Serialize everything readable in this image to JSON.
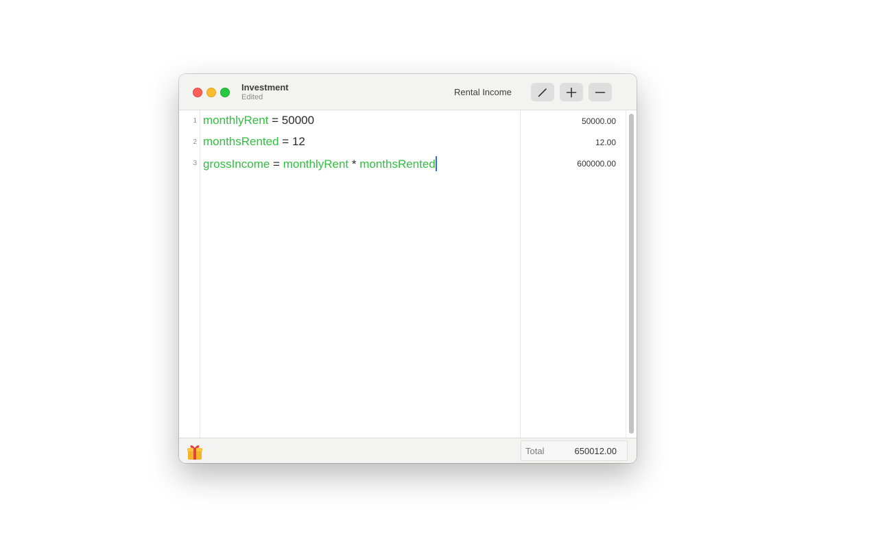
{
  "window": {
    "title": "Investment",
    "subtitle": "Edited",
    "sheet_name": "Rental Income"
  },
  "toolbar": {
    "buttons": [
      {
        "name": "edit",
        "icon": "pencil-icon"
      },
      {
        "name": "add",
        "icon": "plus-icon"
      },
      {
        "name": "remove",
        "icon": "minus-icon"
      }
    ]
  },
  "editor": {
    "lines": [
      {
        "number": "1",
        "tokens": [
          {
            "text": "monthlyRent",
            "kind": "variable"
          },
          {
            "text": " = 50000",
            "kind": "plain"
          }
        ],
        "result": "50000.00"
      },
      {
        "number": "2",
        "tokens": [
          {
            "text": "monthsRented",
            "kind": "variable"
          },
          {
            "text": " = 12",
            "kind": "plain"
          }
        ],
        "result": "12.00"
      },
      {
        "number": "3",
        "tokens": [
          {
            "text": "grossIncome",
            "kind": "variable"
          },
          {
            "text": " = ",
            "kind": "plain"
          },
          {
            "text": "monthlyRent",
            "kind": "variable"
          },
          {
            "text": " * ",
            "kind": "plain"
          },
          {
            "text": "monthsRented",
            "kind": "variable"
          }
        ],
        "result": "600000.00"
      }
    ],
    "variable_color": "#2fc03f",
    "caret_color": "#2a6edc"
  },
  "footer": {
    "gift_icon": "gift-icon",
    "total_label": "Total",
    "total_value": "650012.00"
  },
  "colors": {
    "close": "#fe5f57",
    "minimize": "#febc2e",
    "maximize": "#28c840"
  }
}
